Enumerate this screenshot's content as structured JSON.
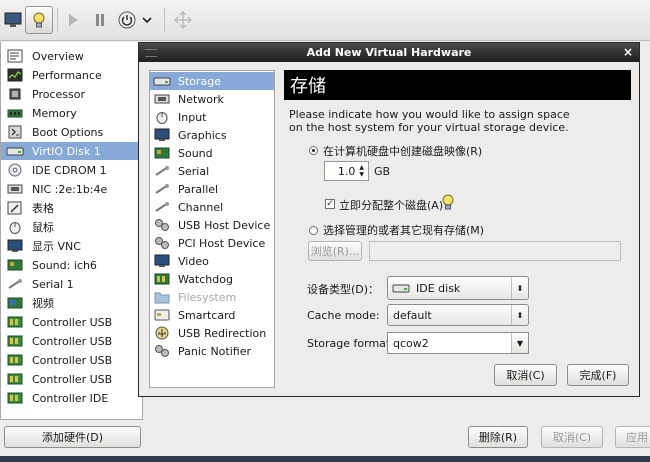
{
  "toolbar": {
    "buttons": [
      "computer-icon",
      "lightbulb-icon",
      "play-icon",
      "pause-icon",
      "power-icon",
      "dropdown-arrow-icon",
      "fullscreen-icon"
    ]
  },
  "left_list": {
    "items": [
      {
        "label": "Overview",
        "icon": "overview-icon"
      },
      {
        "label": "Performance",
        "icon": "performance-icon"
      },
      {
        "label": "Processor",
        "icon": "processor-icon"
      },
      {
        "label": "Memory",
        "icon": "memory-icon"
      },
      {
        "label": "Boot Options",
        "icon": "boot-options-icon"
      },
      {
        "label": "VirtIO Disk 1",
        "icon": "disk-icon",
        "selected": true
      },
      {
        "label": "IDE CDROM 1",
        "icon": "cdrom-icon"
      },
      {
        "label": "NIC :2e:1b:4e",
        "icon": "nic-icon"
      },
      {
        "label": "表格",
        "icon": "tablet-icon"
      },
      {
        "label": "鼠标",
        "icon": "mouse-icon"
      },
      {
        "label": "显示 VNC",
        "icon": "display-icon"
      },
      {
        "label": "Sound: ich6",
        "icon": "sound-icon"
      },
      {
        "label": "Serial 1",
        "icon": "serial-icon"
      },
      {
        "label": "视频",
        "icon": "video-icon"
      },
      {
        "label": "Controller USB",
        "icon": "controller-icon"
      },
      {
        "label": "Controller USB",
        "icon": "controller-icon"
      },
      {
        "label": "Controller USB",
        "icon": "controller-icon"
      },
      {
        "label": "Controller USB",
        "icon": "controller-icon"
      },
      {
        "label": "Controller IDE",
        "icon": "controller-icon"
      }
    ]
  },
  "bottom": {
    "add_hardware": "添加硬件(D)",
    "remove": "删除(R)",
    "cancel": "取消(C)",
    "apply": "应用"
  },
  "dialog": {
    "title": "Add New Virtual Hardware",
    "close": "×",
    "hardware_list": [
      {
        "label": "Storage",
        "icon": "storage-icon",
        "selected": true
      },
      {
        "label": "Network",
        "icon": "network-icon"
      },
      {
        "label": "Input",
        "icon": "input-icon"
      },
      {
        "label": "Graphics",
        "icon": "graphics-icon"
      },
      {
        "label": "Sound",
        "icon": "sound-icon"
      },
      {
        "label": "Serial",
        "icon": "serial-icon"
      },
      {
        "label": "Parallel",
        "icon": "parallel-icon"
      },
      {
        "label": "Channel",
        "icon": "channel-icon"
      },
      {
        "label": "USB Host Device",
        "icon": "usb-host-device-icon"
      },
      {
        "label": "PCI Host Device",
        "icon": "pci-host-device-icon"
      },
      {
        "label": "Video",
        "icon": "video-icon"
      },
      {
        "label": "Watchdog",
        "icon": "watchdog-icon"
      },
      {
        "label": "Filesystem",
        "icon": "filesystem-icon",
        "disabled": true
      },
      {
        "label": "Smartcard",
        "icon": "smartcard-icon"
      },
      {
        "label": "USB Redirection",
        "icon": "usb-redirection-icon"
      },
      {
        "label": "Panic Notifier",
        "icon": "panic-notifier-icon"
      }
    ],
    "header": "存储",
    "description_line1": "Please indicate how you would like to assign space",
    "description_line2": "on the host system for your virtual storage device.",
    "option_create": "在计算机硬盘中创建磁盘映像(R)",
    "size_value": "1.0",
    "size_unit": "GB",
    "allocate_now": "立即分配整个磁盘(A)",
    "option_existing": "选择管理的或者其它现有存储(M)",
    "browse": "浏览(R)...",
    "device_type_label": "设备类型(D)：",
    "device_type_value": "IDE disk",
    "cache_mode_label": "Cache mode:",
    "cache_mode_value": "default",
    "storage_format_label": "Storage format:",
    "storage_format_value": "qcow2",
    "cancel": "取消(C)",
    "finish": "完成(F)"
  }
}
